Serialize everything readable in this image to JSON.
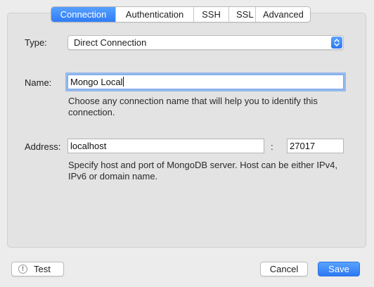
{
  "tabs": [
    {
      "label": "Connection",
      "active": true
    },
    {
      "label": "Authentication",
      "active": false
    },
    {
      "label": "SSH",
      "active": false
    },
    {
      "label": "SSL",
      "active": false
    },
    {
      "label": "Advanced",
      "active": false
    }
  ],
  "connection": {
    "type_label": "Type:",
    "type_value": "Direct Connection",
    "name_label": "Name:",
    "name_value": "Mongo Local",
    "name_hint": "Choose any connection name that will help you to identify this connection.",
    "address_label": "Address:",
    "host_value": "localhost",
    "separator": ":",
    "port_value": "27017",
    "address_hint": "Specify host and port of MongoDB server. Host can be either IPv4, IPv6 or domain name."
  },
  "footer": {
    "test_label": "Test",
    "test_icon_glyph": "!",
    "cancel_label": "Cancel",
    "save_label": "Save"
  },
  "icons": {
    "select_arrow": "chevron-up-down-icon",
    "test_icon": "exclamation-circle-icon"
  },
  "colors": {
    "accent": "#2f7cf6",
    "panel": "#e3e3e3",
    "window": "#ececec"
  }
}
